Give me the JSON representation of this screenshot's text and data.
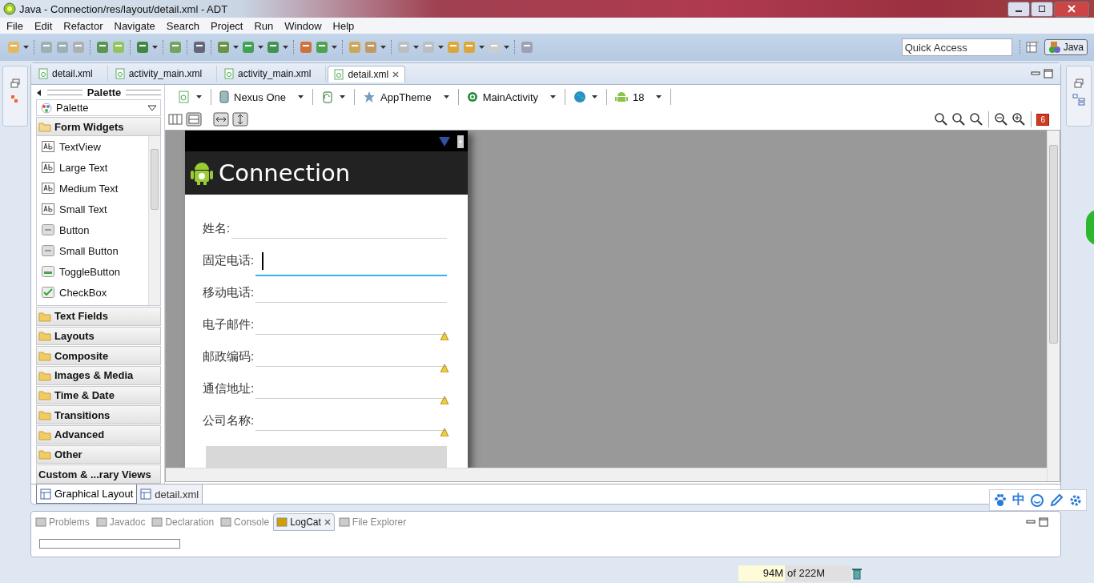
{
  "window": {
    "title": "Java - Connection/res/layout/detail.xml - ADT"
  },
  "menu": [
    "File",
    "Edit",
    "Refactor",
    "Navigate",
    "Search",
    "Project",
    "Run",
    "Window",
    "Help"
  ],
  "quick_access": {
    "placeholder": "Quick Access"
  },
  "perspective": {
    "label": "Java",
    "selected": true
  },
  "editor_tabs": [
    {
      "label": "detail.xml",
      "selected": false
    },
    {
      "label": "activity_main.xml",
      "selected": false
    },
    {
      "label": "activity_main.xml",
      "selected": false
    },
    {
      "label": "detail.xml",
      "selected": true
    }
  ],
  "palette": {
    "title": "Palette",
    "dropdown": "Palette",
    "categories": [
      {
        "label": "Form Widgets",
        "kind": "folder",
        "expanded": true,
        "items": [
          {
            "label": "TextView",
            "kind": "text"
          },
          {
            "label": "Large Text",
            "kind": "text"
          },
          {
            "label": "Medium Text",
            "kind": "text"
          },
          {
            "label": "Small Text",
            "kind": "text"
          },
          {
            "label": "Button",
            "kind": "button"
          },
          {
            "label": "Small Button",
            "kind": "button"
          },
          {
            "label": "ToggleButton",
            "kind": "toggle"
          },
          {
            "label": "CheckBox",
            "kind": "checkbox"
          }
        ]
      },
      {
        "label": "Text Fields",
        "kind": "folder",
        "expanded": false
      },
      {
        "label": "Layouts",
        "kind": "folder",
        "expanded": false
      },
      {
        "label": "Composite",
        "kind": "folder",
        "expanded": false
      },
      {
        "label": "Images & Media",
        "kind": "folder",
        "expanded": false
      },
      {
        "label": "Time & Date",
        "kind": "folder",
        "expanded": false
      },
      {
        "label": "Transitions",
        "kind": "folder",
        "expanded": false
      },
      {
        "label": "Advanced",
        "kind": "folder",
        "expanded": false
      },
      {
        "label": "Other",
        "kind": "folder",
        "expanded": false
      },
      {
        "label": "Custom & ...rary Views",
        "kind": "plain",
        "expanded": false
      }
    ]
  },
  "config_toolbar": [
    {
      "kind": "file"
    },
    {
      "kind": "device",
      "label": "Nexus One"
    },
    {
      "kind": "orientation"
    },
    {
      "kind": "theme",
      "label": "AppTheme"
    },
    {
      "kind": "activity",
      "label": "MainActivity"
    },
    {
      "kind": "locale"
    },
    {
      "kind": "api",
      "label": "18"
    }
  ],
  "error_count": "6",
  "device": {
    "app_title": "Connection",
    "fields": [
      {
        "label": "姓名:",
        "focused": false,
        "warning": false
      },
      {
        "label": "固定电话:",
        "focused": true,
        "warning": false
      },
      {
        "label": "移动电话:",
        "focused": false,
        "warning": false
      },
      {
        "label": "电子邮件:",
        "focused": false,
        "warning": true
      },
      {
        "label": "邮政编码:",
        "focused": false,
        "warning": true
      },
      {
        "label": "通信地址:",
        "focused": false,
        "warning": true
      },
      {
        "label": "公司名称:",
        "focused": false,
        "warning": true
      }
    ]
  },
  "layout_tabs": [
    {
      "label": "Graphical Layout",
      "selected": true
    },
    {
      "label": "detail.xml",
      "selected": false
    }
  ],
  "bottom_tabs": [
    {
      "label": "Problems",
      "selected": false
    },
    {
      "label": "Javadoc",
      "selected": false
    },
    {
      "label": "Declaration",
      "selected": false
    },
    {
      "label": "Console",
      "selected": false
    },
    {
      "label": "LogCat",
      "selected": true
    },
    {
      "label": "File Explorer",
      "selected": false
    }
  ],
  "ime_toolbar": {
    "mode": "中"
  },
  "status_bar": {
    "heap_used": "94M",
    "heap_total": "of 222M"
  }
}
